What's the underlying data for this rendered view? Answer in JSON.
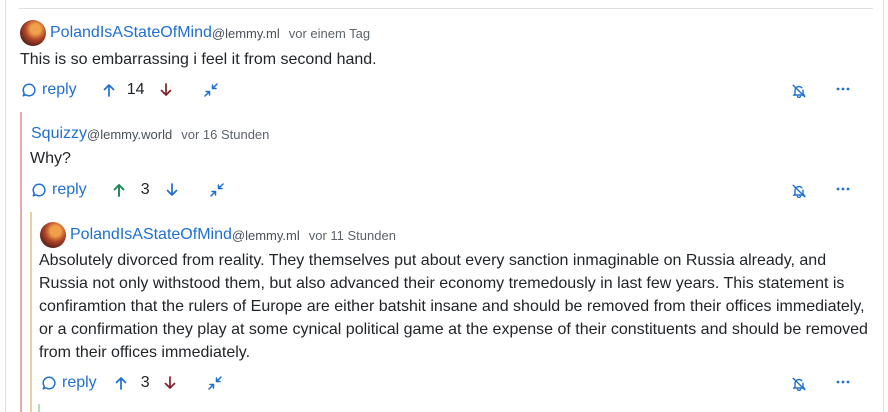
{
  "colors": {
    "link": "#1f6fd1",
    "upvoted": "#198754",
    "downvote": "#842029",
    "thread_level_1": "#e8a8ad",
    "thread_level_2": "#e6d29a",
    "thread_level_3": "#b8ddb0"
  },
  "icons": {
    "reply": "speech-bubble-icon",
    "upvote": "arrow-up-icon",
    "downvote": "arrow-down-icon",
    "collapse": "collapse-icon",
    "notifications": "bell-off-icon",
    "more": "ellipsis-icon"
  },
  "comments": [
    {
      "author": "PolandIsAStateOfMind",
      "instance": "@lemmy.ml",
      "time": "vor einem Tag",
      "body": "This is so embarrassing i feel it from second hand.",
      "reply_label": "reply",
      "score": "14",
      "upvoted": false
    },
    {
      "author": "Squizzy",
      "instance": "@lemmy.world",
      "time": "vor 16 Stunden",
      "body": "Why?",
      "reply_label": "reply",
      "score": "3",
      "upvoted": true
    },
    {
      "author": "PolandIsAStateOfMind",
      "instance": "@lemmy.ml",
      "time": "vor 11 Stunden",
      "body": "Absolutely divorced from reality. They themselves put about every sanction inmaginable on Russia already, and Russia not only withstood them, but also advanced their economy tremedously in last few years. This statement is confiramtion that the rulers of Europe are either batshit insane and should be removed from their offices immediately, or a confirmation they play at some cynical political game at the expense of their constituents and should be removed from their offices immediately.",
      "reply_label": "reply",
      "score": "3",
      "upvoted": false
    }
  ]
}
